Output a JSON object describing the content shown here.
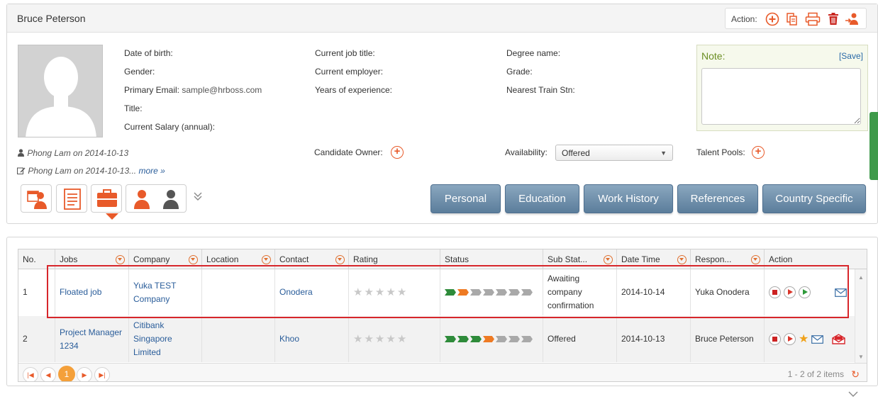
{
  "candidate": {
    "name": "Bruce Peterson"
  },
  "action_bar": {
    "label": "Action:"
  },
  "fields": {
    "dob": "Date of birth:",
    "gender": "Gender:",
    "email_label": "Primary Email:",
    "email_value": "sample@hrboss.com",
    "title": "Title:",
    "salary": "Current Salary (annual):",
    "job_title": "Current job title:",
    "employer": "Current employer:",
    "experience": "Years of experience:",
    "degree": "Degree name:",
    "grade": "Grade:",
    "train": "Nearest Train Stn:"
  },
  "meta": {
    "created": "Phong Lam on 2014-10-13",
    "edited": "Phong Lam on 2014-10-13...",
    "more": "more »"
  },
  "owner_label": "Candidate Owner:",
  "availability": {
    "label": "Availability:",
    "value": "Offered"
  },
  "talent_pools_label": "Talent Pools:",
  "note": {
    "label": "Note:",
    "save": "[Save]"
  },
  "tabs": [
    "Personal",
    "Education",
    "Work History",
    "References",
    "Country Specific"
  ],
  "grid": {
    "headers": [
      "No.",
      "Jobs",
      "Company",
      "Location",
      "Contact",
      "Rating",
      "Status",
      "Sub Stat...",
      "Date Time",
      "Respon...",
      "Action"
    ],
    "rows": [
      {
        "no": "1",
        "job": "Floated job",
        "company": "Yuka TEST Company",
        "location": "",
        "contact": "Onodera",
        "rating": 0,
        "status": [
          "green",
          "orange",
          "gray",
          "gray",
          "gray",
          "gray",
          "gray"
        ],
        "sub_status": "Awaiting company confirmation",
        "date": "2014-10-14",
        "responsible": "Yuka Onodera"
      },
      {
        "no": "2",
        "job": "Project Manager 1234",
        "company": "Citibank Singapore Limited",
        "location": "",
        "contact": "Khoo",
        "rating": 0,
        "status": [
          "green",
          "green",
          "green",
          "orange",
          "gray",
          "gray",
          "gray"
        ],
        "sub_status": "Offered",
        "date": "2014-10-13",
        "responsible": "Bruce Peterson"
      }
    ]
  },
  "pager": {
    "current": "1",
    "summary": "1 - 2 of 2 items"
  }
}
